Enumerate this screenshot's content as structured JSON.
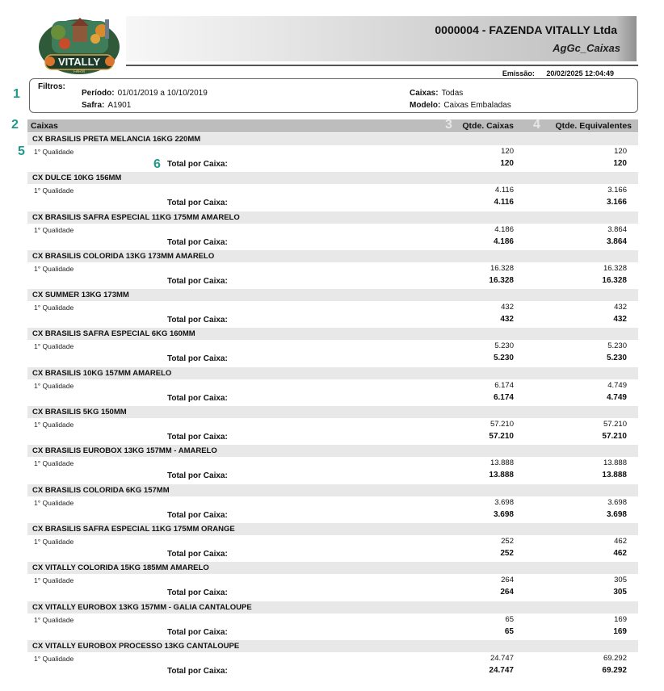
{
  "logo": {
    "brand": "VITALLY",
    "sub": "FARM"
  },
  "header": {
    "company": "0000004 - FAZENDA VITALLY Ltda",
    "report_code": "AgGc_Caixas",
    "emissao_label": "Emissão:",
    "emissao_value": "20/02/2025 12:04:49"
  },
  "markers": {
    "m1": "1",
    "m2": "2",
    "m3": "3",
    "m4": "4",
    "m5": "5",
    "m6": "6"
  },
  "filters": {
    "title": "Filtros:",
    "periodo_label": "Período:",
    "periodo_value": "01/01/2019 a 10/10/2019",
    "safra_label": "Safra:",
    "safra_value": "A1901",
    "caixas_label": "Caixas:",
    "caixas_value": "Todas",
    "modelo_label": "Modelo:",
    "modelo_value": "Caixas Embaladas"
  },
  "columns": {
    "caixas": "Caixas",
    "qtde_caixas": "Qtde. Caixas",
    "qtde_equivalentes": "Qtde. Equivalentes"
  },
  "total_label": "Total por Caixa:",
  "groups": [
    {
      "name": "CX BRASILIS PRETA  MELANCIA 16KG 220MM",
      "quality": "1° Qualidade",
      "qtde": "120",
      "equiv": "120",
      "total_qtde": "120",
      "total_equiv": "120"
    },
    {
      "name": "CX DULCE 10KG 156MM",
      "quality": "1° Qualidade",
      "qtde": "4.116",
      "equiv": "3.166",
      "total_qtde": "4.116",
      "total_equiv": "3.166"
    },
    {
      "name": "CX BRASILIS SAFRA ESPECIAL 11KG 175MM AMARELO",
      "quality": "1° Qualidade",
      "qtde": "4.186",
      "equiv": "3.864",
      "total_qtde": "4.186",
      "total_equiv": "3.864"
    },
    {
      "name": "CX BRASILIS COLORIDA 13KG 173MM AMARELO",
      "quality": "1° Qualidade",
      "qtde": "16.328",
      "equiv": "16.328",
      "total_qtde": "16.328",
      "total_equiv": "16.328"
    },
    {
      "name": "CX SUMMER 13KG 173MM",
      "quality": "1° Qualidade",
      "qtde": "432",
      "equiv": "432",
      "total_qtde": "432",
      "total_equiv": "432"
    },
    {
      "name": "CX BRASILIS SAFRA ESPECIAL 6KG 160MM",
      "quality": "1° Qualidade",
      "qtde": "5.230",
      "equiv": "5.230",
      "total_qtde": "5.230",
      "total_equiv": "5.230"
    },
    {
      "name": "CX BRASILIS 10KG 157MM AMARELO",
      "quality": "1° Qualidade",
      "qtde": "6.174",
      "equiv": "4.749",
      "total_qtde": "6.174",
      "total_equiv": "4.749"
    },
    {
      "name": "CX BRASILIS 5KG 150MM",
      "quality": "1° Qualidade",
      "qtde": "57.210",
      "equiv": "57.210",
      "total_qtde": "57.210",
      "total_equiv": "57.210"
    },
    {
      "name": "CX BRASILIS EUROBOX 13KG 157MM - AMARELO",
      "quality": "1° Qualidade",
      "qtde": "13.888",
      "equiv": "13.888",
      "total_qtde": "13.888",
      "total_equiv": "13.888"
    },
    {
      "name": "CX BRASILIS COLORIDA 6KG 157MM",
      "quality": "1° Qualidade",
      "qtde": "3.698",
      "equiv": "3.698",
      "total_qtde": "3.698",
      "total_equiv": "3.698"
    },
    {
      "name": "CX BRASILIS SAFRA ESPECIAL 11KG 175MM ORANGE",
      "quality": "1° Qualidade",
      "qtde": "252",
      "equiv": "462",
      "total_qtde": "252",
      "total_equiv": "462"
    },
    {
      "name": "CX VITALLY COLORIDA 15KG 185MM AMARELO",
      "quality": "1° Qualidade",
      "qtde": "264",
      "equiv": "305",
      "total_qtde": "264",
      "total_equiv": "305"
    },
    {
      "name": "CX VITALLY EUROBOX 13KG 157MM - GALIA CANTALOUPE",
      "quality": "1° Qualidade",
      "qtde": "65",
      "equiv": "169",
      "total_qtde": "65",
      "total_equiv": "169"
    },
    {
      "name": "CX VITALLY EUROBOX PROCESSO 13KG CANTALOUPE",
      "quality": "1° Qualidade",
      "qtde": "24.747",
      "equiv": "69.292",
      "total_qtde": "24.747",
      "total_equiv": "69.292"
    }
  ]
}
